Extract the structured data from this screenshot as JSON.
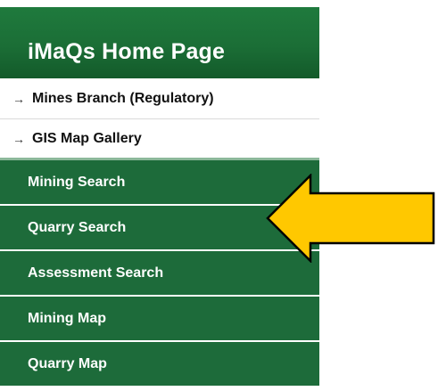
{
  "header": {
    "title": "iMaQs Home Page"
  },
  "white_items": [
    {
      "label": "Mines Branch (Regulatory)",
      "bullet": "→"
    },
    {
      "label": "GIS Map Gallery",
      "bullet": "→"
    }
  ],
  "green_items": [
    {
      "label": "Mining Search"
    },
    {
      "label": "Quarry Search"
    },
    {
      "label": "Assessment Search"
    },
    {
      "label": "Mining Map"
    },
    {
      "label": "Quarry Map"
    }
  ],
  "colors": {
    "nav_green": "#1d6b3a",
    "arrow_fill": "#ffc800",
    "arrow_stroke": "#000000"
  }
}
